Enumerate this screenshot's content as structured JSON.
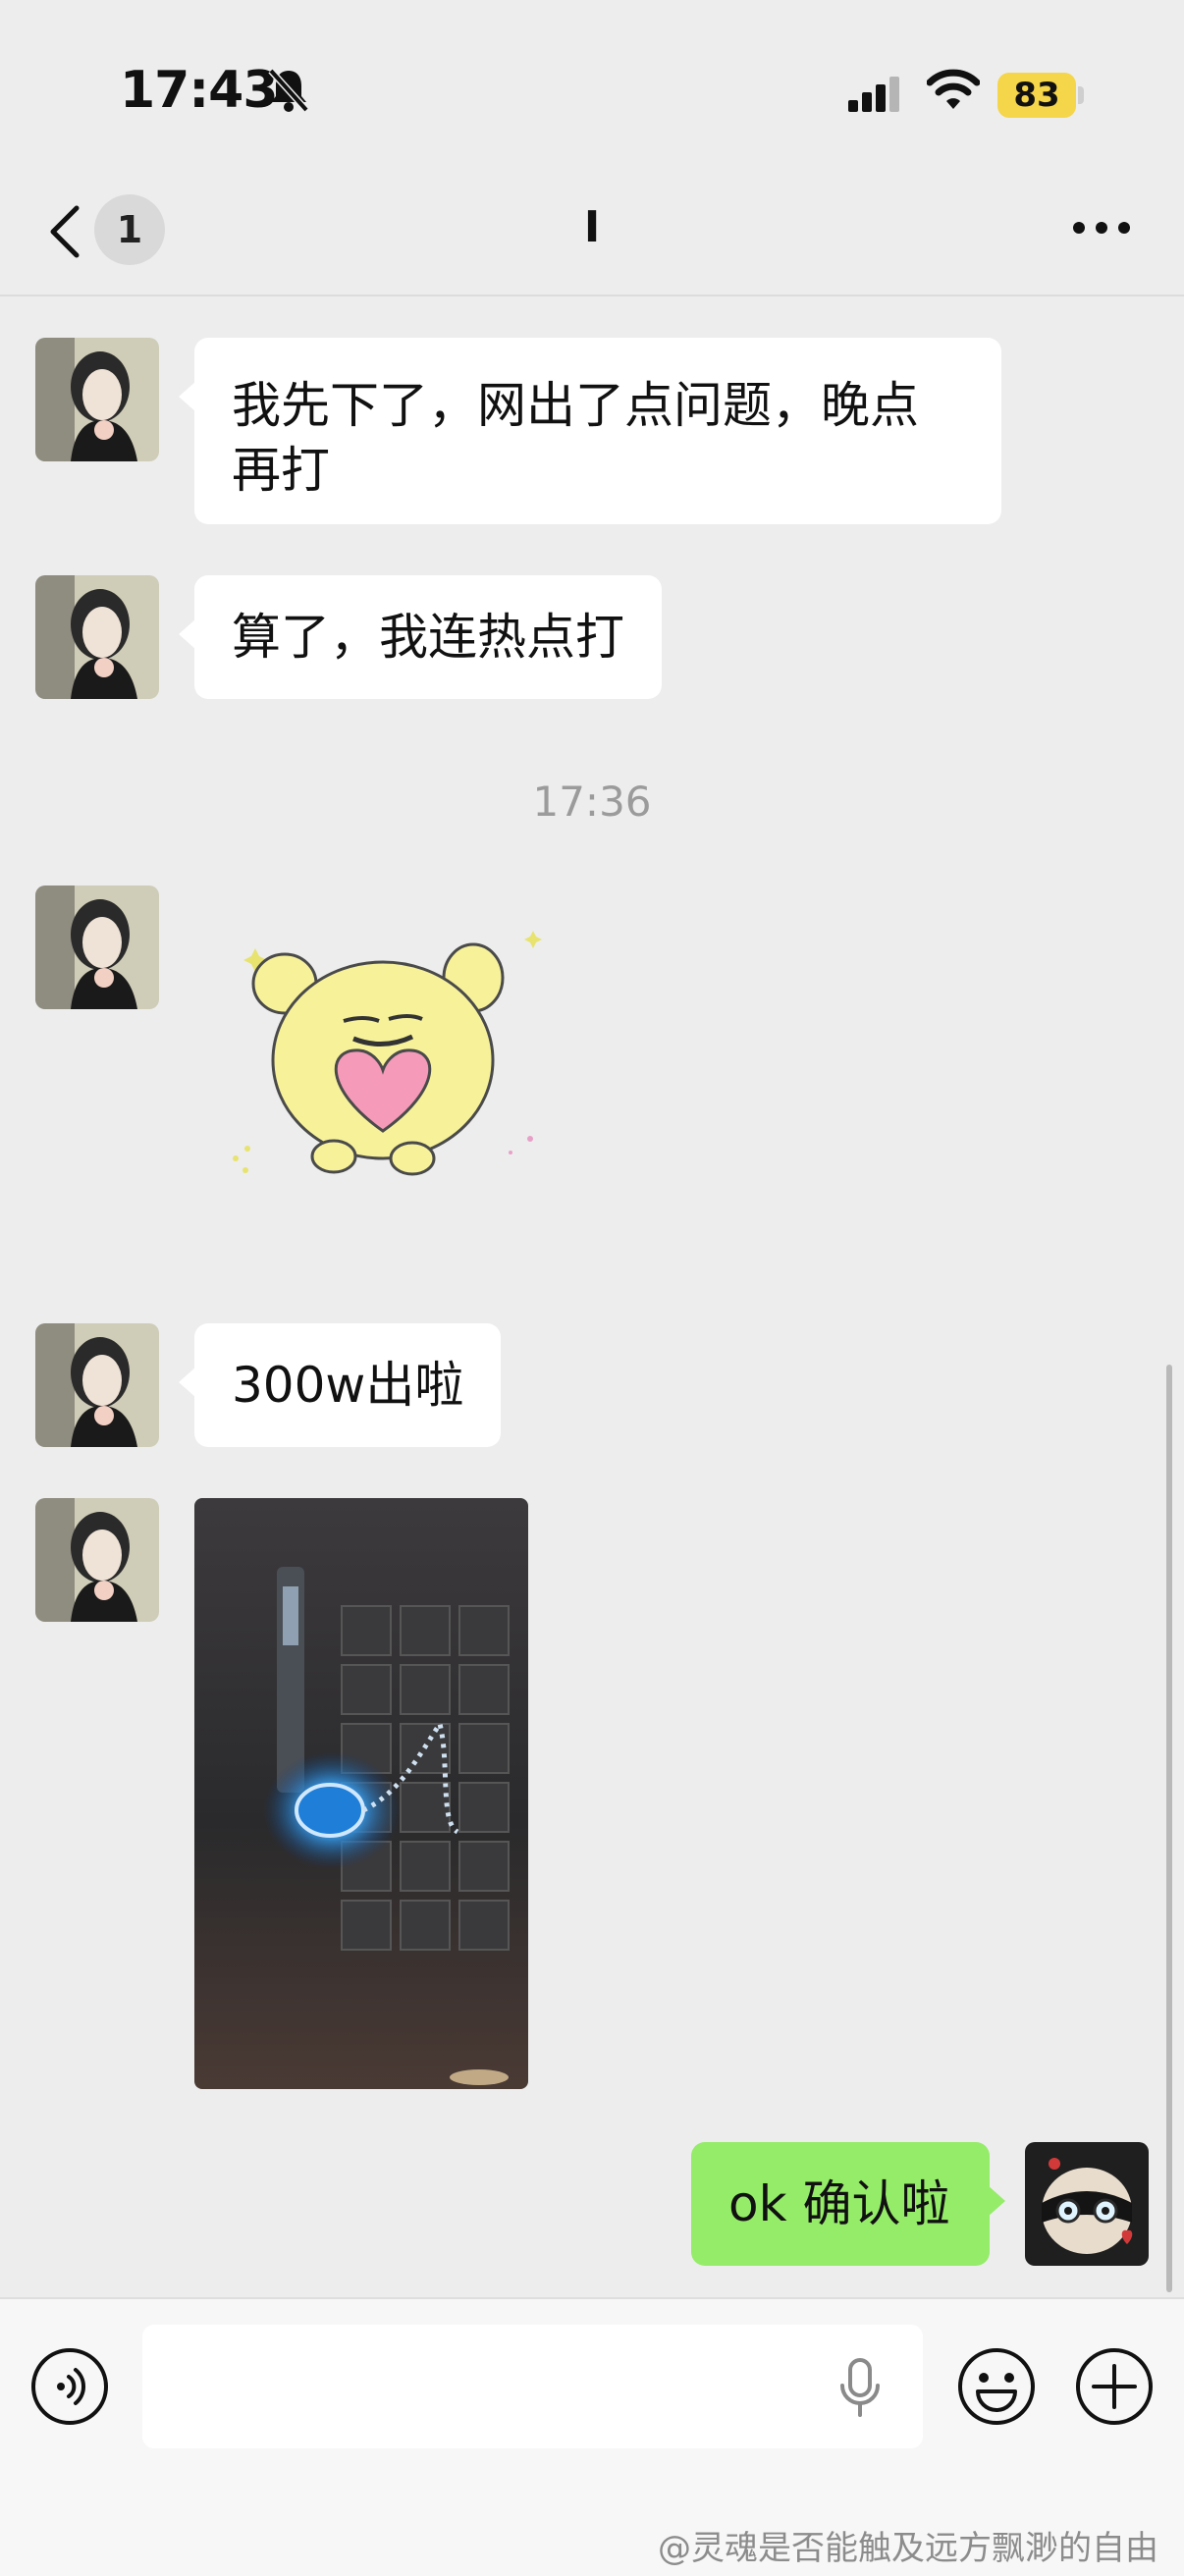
{
  "status_bar": {
    "time": "17:43",
    "battery": "83"
  },
  "nav": {
    "unread_count": "1",
    "title": "I"
  },
  "messages": [
    {
      "sender": "other",
      "type": "text",
      "text": "我先下了，网出了点问题，晚点再打"
    },
    {
      "sender": "other",
      "type": "text",
      "text": "算了，我连热点打"
    },
    {
      "type": "timestamp",
      "text": "17:36"
    },
    {
      "sender": "other",
      "type": "sticker",
      "sticker": "yellow-bear-holding-heart"
    },
    {
      "sender": "other",
      "type": "text",
      "text": "300w出啦"
    },
    {
      "sender": "other",
      "type": "image",
      "image": "game-screenshot-blue-pendant"
    },
    {
      "sender": "me",
      "type": "text",
      "text": "ok 确认啦"
    }
  ],
  "input": {
    "placeholder": ""
  },
  "colors": {
    "background": "#ededed",
    "my_bubble": "#95ec69",
    "other_bubble": "#ffffff",
    "battery": "#f5d54a"
  },
  "icons": [
    "bell-slash-icon",
    "signal-icon",
    "wifi-icon",
    "back-icon",
    "more-icon",
    "voice-icon",
    "mic-icon",
    "emoji-icon",
    "plus-icon"
  ],
  "watermark": "@灵魂是否能触及远方飘渺的自由"
}
